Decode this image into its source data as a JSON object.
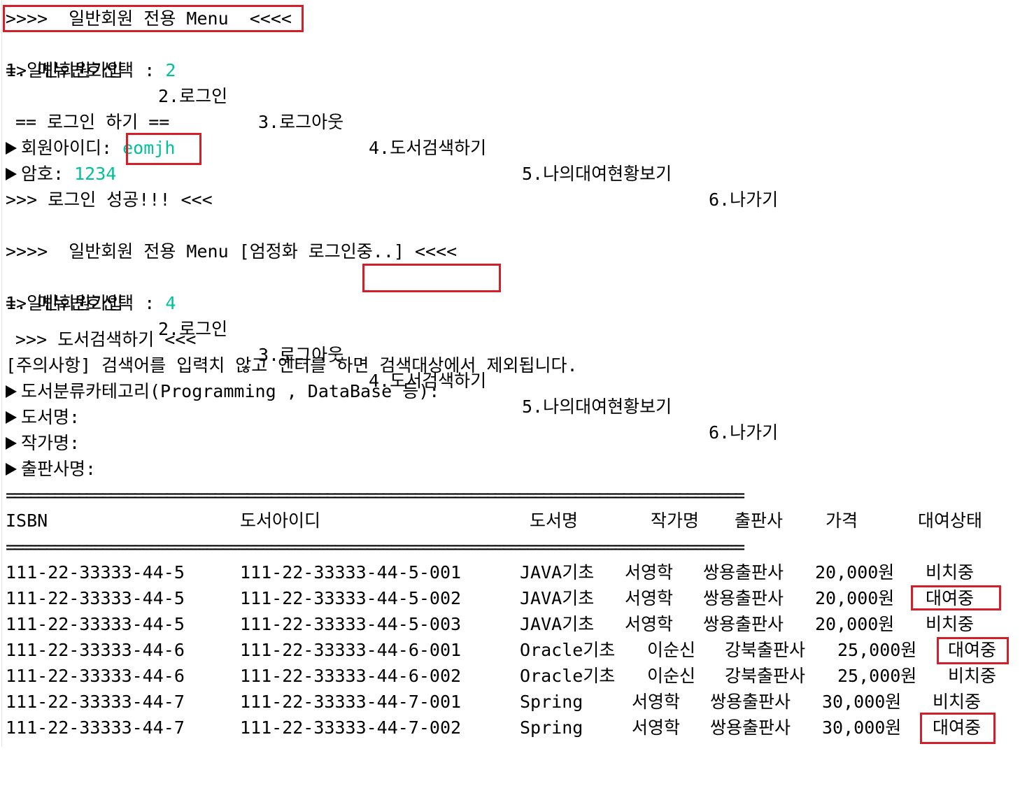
{
  "menu_header_1": ">>>>  일반회원 전용 Menu  <<<<",
  "menu_items": [
    "1.일반회원가입",
    "2.로그인",
    "3.로그아웃",
    "4.도서검색하기",
    "5.나의대여현황보기",
    "6.나가기"
  ],
  "menu_prompt": "=> 메뉴번호선택 : ",
  "menu_choice_1": "2",
  "login": {
    "title": "== 로그인 하기 ==",
    "id_label": "회원아이디: ",
    "id_value": "eomjh",
    "pw_label": "암호: ",
    "pw_value": "1234",
    "success": ">>> 로그인 성공!!! <<<"
  },
  "menu_header_2": ">>>>  일반회원 전용 Menu [엄정화 로그인중..] <<<<",
  "menu_choice_2": "4",
  "search": {
    "title": ">>> 도서검색하기 <<<",
    "notice": "[주의사항] 검색어를 입력치 않고 엔터를 하면 검색대상에서 제외됩니다.",
    "fields": [
      "도서분류카테고리(Programming , DataBase 등):",
      "도서명:",
      "작가명:",
      "출판사명:"
    ]
  },
  "separator": "============================================================================================",
  "table": {
    "headers": [
      "ISBN",
      "도서아이디",
      "도서명",
      "작가명",
      "출판사",
      "가격",
      "대여상태"
    ],
    "rows": [
      [
        "111-22-33333-44-5",
        "111-22-33333-44-5-001",
        "JAVA기초",
        "서영학",
        "쌍용출판사",
        "20,000원",
        "비치중"
      ],
      [
        "111-22-33333-44-5",
        "111-22-33333-44-5-002",
        "JAVA기초",
        "서영학",
        "쌍용출판사",
        "20,000원",
        "대여중"
      ],
      [
        "111-22-33333-44-5",
        "111-22-33333-44-5-003",
        "JAVA기초",
        "서영학",
        "쌍용출판사",
        "20,000원",
        "비치중"
      ],
      [
        "111-22-33333-44-6",
        "111-22-33333-44-6-001",
        "Oracle기초",
        "이순신",
        "강북출판사",
        "25,000원",
        "대여중"
      ],
      [
        "111-22-33333-44-6",
        "111-22-33333-44-6-002",
        "Oracle기초",
        "이순신",
        "강북출판사",
        "25,000원",
        "비치중"
      ],
      [
        "111-22-33333-44-7",
        "111-22-33333-44-7-001",
        "Spring",
        "서영학",
        "쌍용출판사",
        "30,000원",
        "비치중"
      ],
      [
        "111-22-33333-44-7",
        "111-22-33333-44-7-002",
        "Spring",
        "서영학",
        "쌍용출판사",
        "30,000원",
        "대여중"
      ]
    ]
  },
  "colors": {
    "input": "#00c29a",
    "highlight": "#d21f2a"
  }
}
